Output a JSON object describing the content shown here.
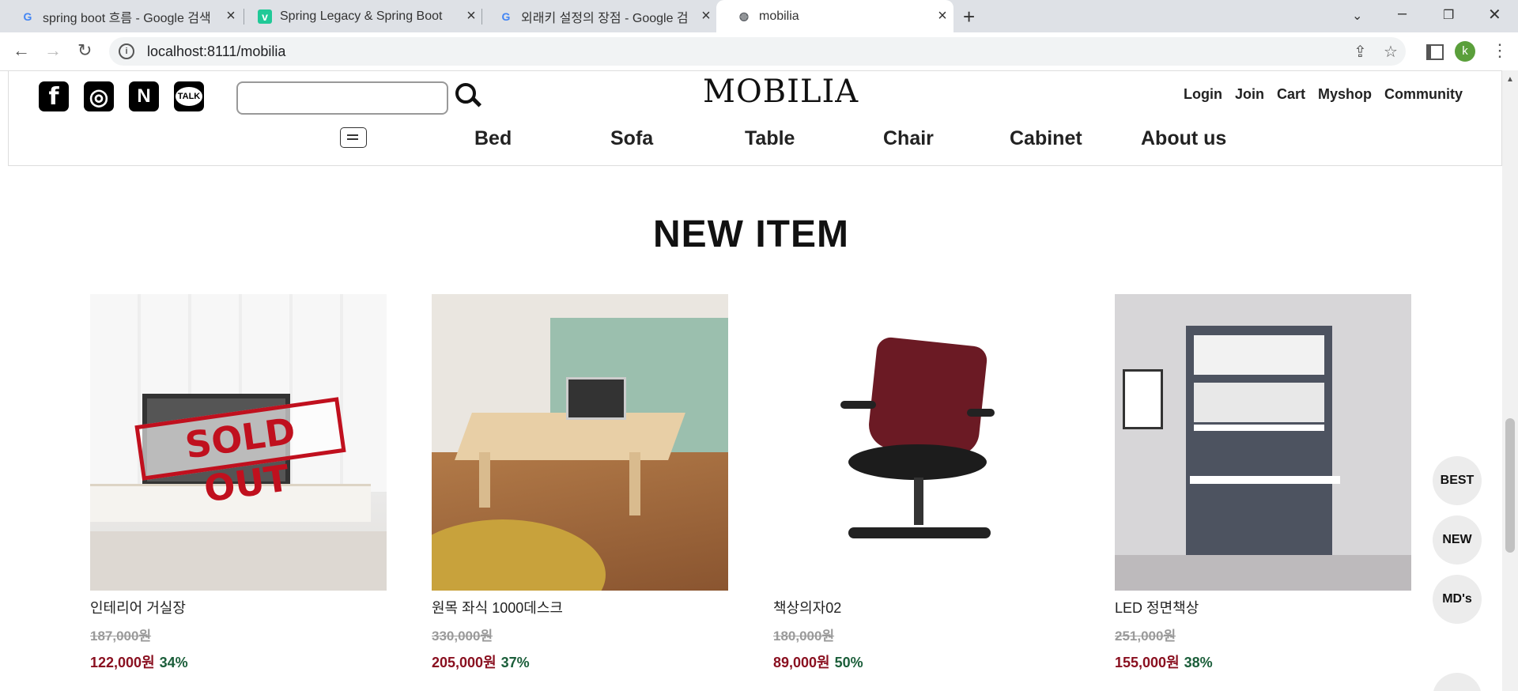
{
  "browser": {
    "tabs": [
      {
        "title": "spring boot 흐름 - Google 검색",
        "favicon": "google-icon"
      },
      {
        "title": "Spring Legacy & Spring Boot",
        "favicon": "velog-icon"
      },
      {
        "title": "외래키 설정의 장점 - Google 검",
        "favicon": "google-icon"
      },
      {
        "title": "mobilia",
        "favicon": "globe-icon"
      }
    ],
    "url": "localhost:8111/mobilia",
    "profile_initial": "k"
  },
  "header": {
    "logo": "MOBILIA",
    "social": [
      {
        "name": "facebook",
        "glyph": "f"
      },
      {
        "name": "instagram",
        "glyph": "◎"
      },
      {
        "name": "naver",
        "glyph": "N"
      },
      {
        "name": "kakaotalk",
        "glyph": "TALK"
      }
    ],
    "search_placeholder": "",
    "top_links": [
      "Login",
      "Join",
      "Cart",
      "Myshop",
      "Community"
    ],
    "categories": [
      "Bed",
      "Sofa",
      "Table",
      "Chair",
      "Cabinet",
      "About us"
    ]
  },
  "section": {
    "title": "NEW ITEM"
  },
  "products": [
    {
      "name": "인테리어 거실장",
      "original_price": "187,000원",
      "sale_price": "122,000원",
      "discount": "34%",
      "sold_out": true,
      "sold_out_label": "SOLD OUT"
    },
    {
      "name": "원목 좌식 1000데스크",
      "original_price": "330,000원",
      "sale_price": "205,000원",
      "discount": "37%",
      "sold_out": false
    },
    {
      "name": "책상의자02",
      "original_price": "180,000원",
      "sale_price": "89,000원",
      "discount": "50%",
      "sold_out": false
    },
    {
      "name": "LED 정면책상",
      "original_price": "251,000원",
      "sale_price": "155,000원",
      "discount": "38%",
      "sold_out": false
    }
  ],
  "floating_menu": [
    "BEST",
    "NEW",
    "MD's"
  ],
  "colors": {
    "sale_price": "#8a1020",
    "discount": "#1b5e3a",
    "original_price": "#9a9a9a"
  }
}
